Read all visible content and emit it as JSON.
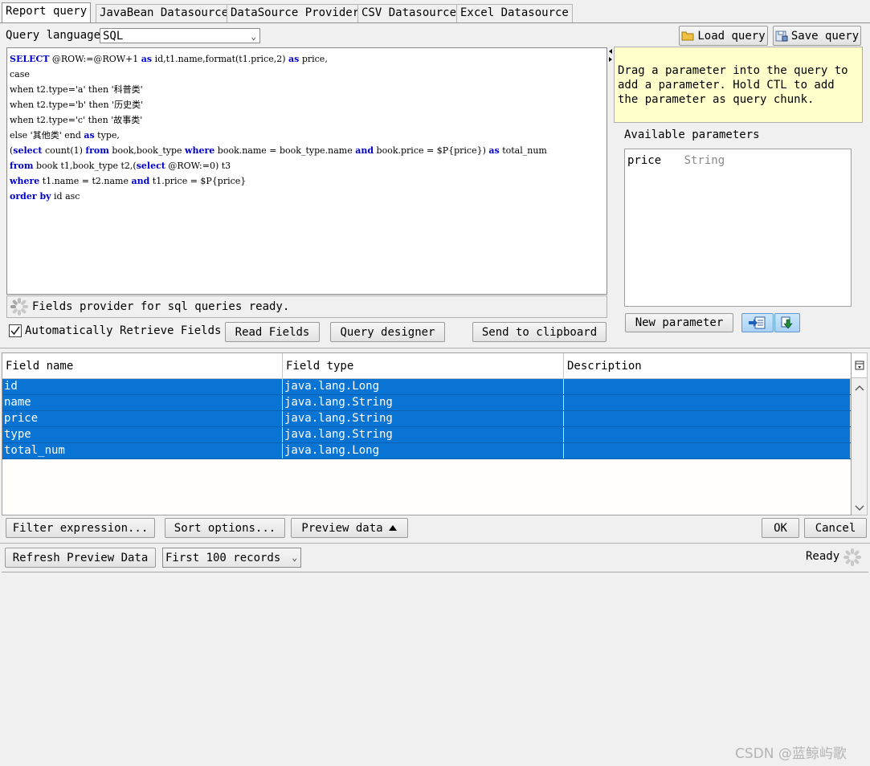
{
  "tabs": [
    {
      "label": "Report query",
      "active": true
    },
    {
      "label": "JavaBean Datasource"
    },
    {
      "label": "DataSource Provider"
    },
    {
      "label": "CSV Datasource"
    },
    {
      "label": "Excel Datasource"
    }
  ],
  "query": {
    "language_label": "Query language",
    "language_value": "SQL",
    "load_label": "Load query",
    "save_label": "Save query"
  },
  "sql_lines": [
    [
      {
        "k": 1,
        "t": "SELECT"
      },
      {
        "t": " @ROW:=@ROW+1 "
      },
      {
        "k": 1,
        "t": "as"
      },
      {
        "t": " id,t1.name,format(t1.price,2) "
      },
      {
        "k": 1,
        "t": "as"
      },
      {
        "t": " price,"
      }
    ],
    [
      {
        "t": "case"
      }
    ],
    [
      {
        "t": "when t2.type='a' then '科普类'"
      }
    ],
    [
      {
        "t": "when t2.type='b' then '历史类'"
      }
    ],
    [
      {
        "t": "when t2.type='c' then '故事类'"
      }
    ],
    [
      {
        "t": "else '其他类' end "
      },
      {
        "k": 1,
        "t": "as"
      },
      {
        "t": " type,"
      }
    ],
    [
      {
        "t": "("
      },
      {
        "k": 1,
        "t": "select"
      },
      {
        "t": " count(1) "
      },
      {
        "k": 1,
        "t": "from"
      },
      {
        "t": " book,book_type "
      },
      {
        "k": 1,
        "t": "where"
      },
      {
        "t": " book.name = book_type.name "
      },
      {
        "k": 1,
        "t": "and"
      },
      {
        "t": " book.price = $P{price}) "
      },
      {
        "k": 1,
        "t": "as"
      },
      {
        "t": " total_num"
      }
    ],
    [
      {
        "k": 1,
        "t": "from"
      },
      {
        "t": " book t1,book_type t2,("
      },
      {
        "k": 1,
        "t": "select"
      },
      {
        "t": " @ROW:=0) t3"
      }
    ],
    [
      {
        "k": 1,
        "t": "where"
      },
      {
        "t": " t1.name = t2.name "
      },
      {
        "k": 1,
        "t": "and"
      },
      {
        "t": " t1.price = $P{price}"
      }
    ],
    [
      {
        "k": 1,
        "t": "order by"
      },
      {
        "t": " id asc"
      }
    ]
  ],
  "status": {
    "fields_provider": "Fields provider for sql queries ready.",
    "auto_retrieve_label": "Automatically Retrieve Fields",
    "auto_retrieve_checked": true,
    "read_fields": "Read Fields",
    "query_designer": "Query designer",
    "send_clipboard": "Send to clipboard"
  },
  "parameters": {
    "hint": "Drag a parameter into the query to add a parameter. Hold CTL to add the parameter as query chunk.",
    "available_label": "Available parameters",
    "items": [
      {
        "name": "price",
        "type": "String"
      }
    ],
    "new_parameter": "New parameter"
  },
  "fields_table": {
    "headers": [
      "Field name",
      "Field type",
      "Description"
    ],
    "rows": [
      {
        "name": "id",
        "type": "java.lang.Long",
        "desc": ""
      },
      {
        "name": "name",
        "type": "java.lang.String",
        "desc": ""
      },
      {
        "name": "price",
        "type": "java.lang.String",
        "desc": ""
      },
      {
        "name": "type",
        "type": "java.lang.String",
        "desc": ""
      },
      {
        "name": "total_num",
        "type": "java.lang.Long",
        "desc": ""
      }
    ],
    "selection_color": "#0a74d4"
  },
  "bottom_buttons": {
    "filter": "Filter expression...",
    "sort": "Sort options...",
    "preview": "Preview data",
    "ok": "OK",
    "cancel": "Cancel"
  },
  "preview": {
    "refresh": "Refresh Preview Data",
    "records": "First 100 records",
    "status": "Ready"
  },
  "watermark": "CSDN @蓝鲸屿歌"
}
